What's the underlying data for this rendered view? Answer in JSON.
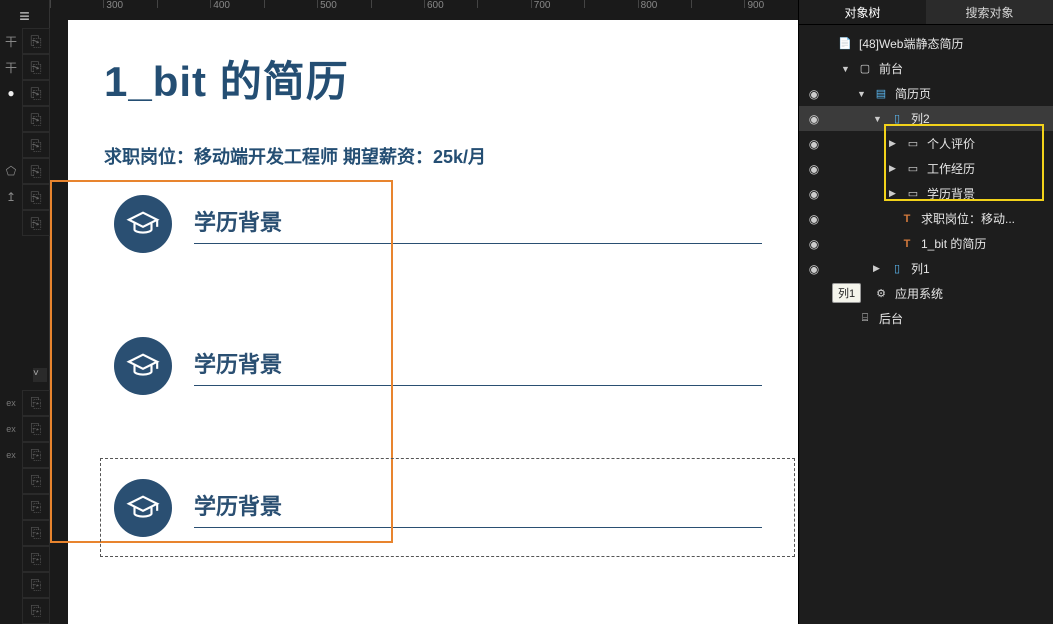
{
  "ruler": [
    "",
    "300",
    "",
    "400",
    "",
    "500",
    "",
    "600",
    "",
    "700",
    "",
    "800",
    "",
    "900"
  ],
  "resume": {
    "title": "1_bit 的简历",
    "subtitle": "求职岗位：移动端开发工程师  期望薪资：25k/月",
    "sections": [
      "学历背景",
      "学历背景",
      "学历背景"
    ]
  },
  "tabs": {
    "object_tree": "对象树",
    "search": "搜索对象"
  },
  "tree": {
    "n0": "[48]Web端静态简历",
    "n1": "前台",
    "n2": "简历页",
    "n3": "列2",
    "n4": "个人评价",
    "n5": "工作经历",
    "n6": "学历背景",
    "n7": "求职岗位：移动...",
    "n8": "1_bit 的简历",
    "n9": "列1",
    "n10": "应用系统",
    "n11": "后台"
  },
  "tooltip": "列1"
}
